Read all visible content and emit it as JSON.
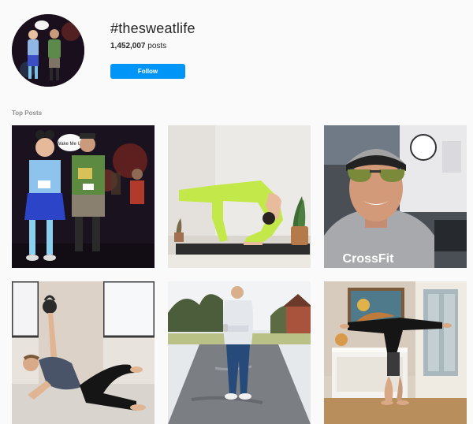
{
  "header": {
    "hashtag": "#thesweatlife",
    "post_count": "1,452,007",
    "posts_word": "posts",
    "follow_label": "Follow"
  },
  "section": {
    "top_posts_label": "Top Posts"
  },
  "colors": {
    "accent": "#0095f6",
    "background": "#fafafa",
    "muted": "#8e8e8e"
  },
  "posts": [
    {
      "subject": "costumed runners race",
      "sign_text": "Wake Me Up"
    },
    {
      "subject": "yoga backbend pose"
    },
    {
      "subject": "man selfie with sunglasses",
      "shirt_text": "CrossFit"
    },
    {
      "subject": "kettlebell floor exercise"
    },
    {
      "subject": "woman on driveway"
    },
    {
      "subject": "handstand in living room"
    }
  ]
}
